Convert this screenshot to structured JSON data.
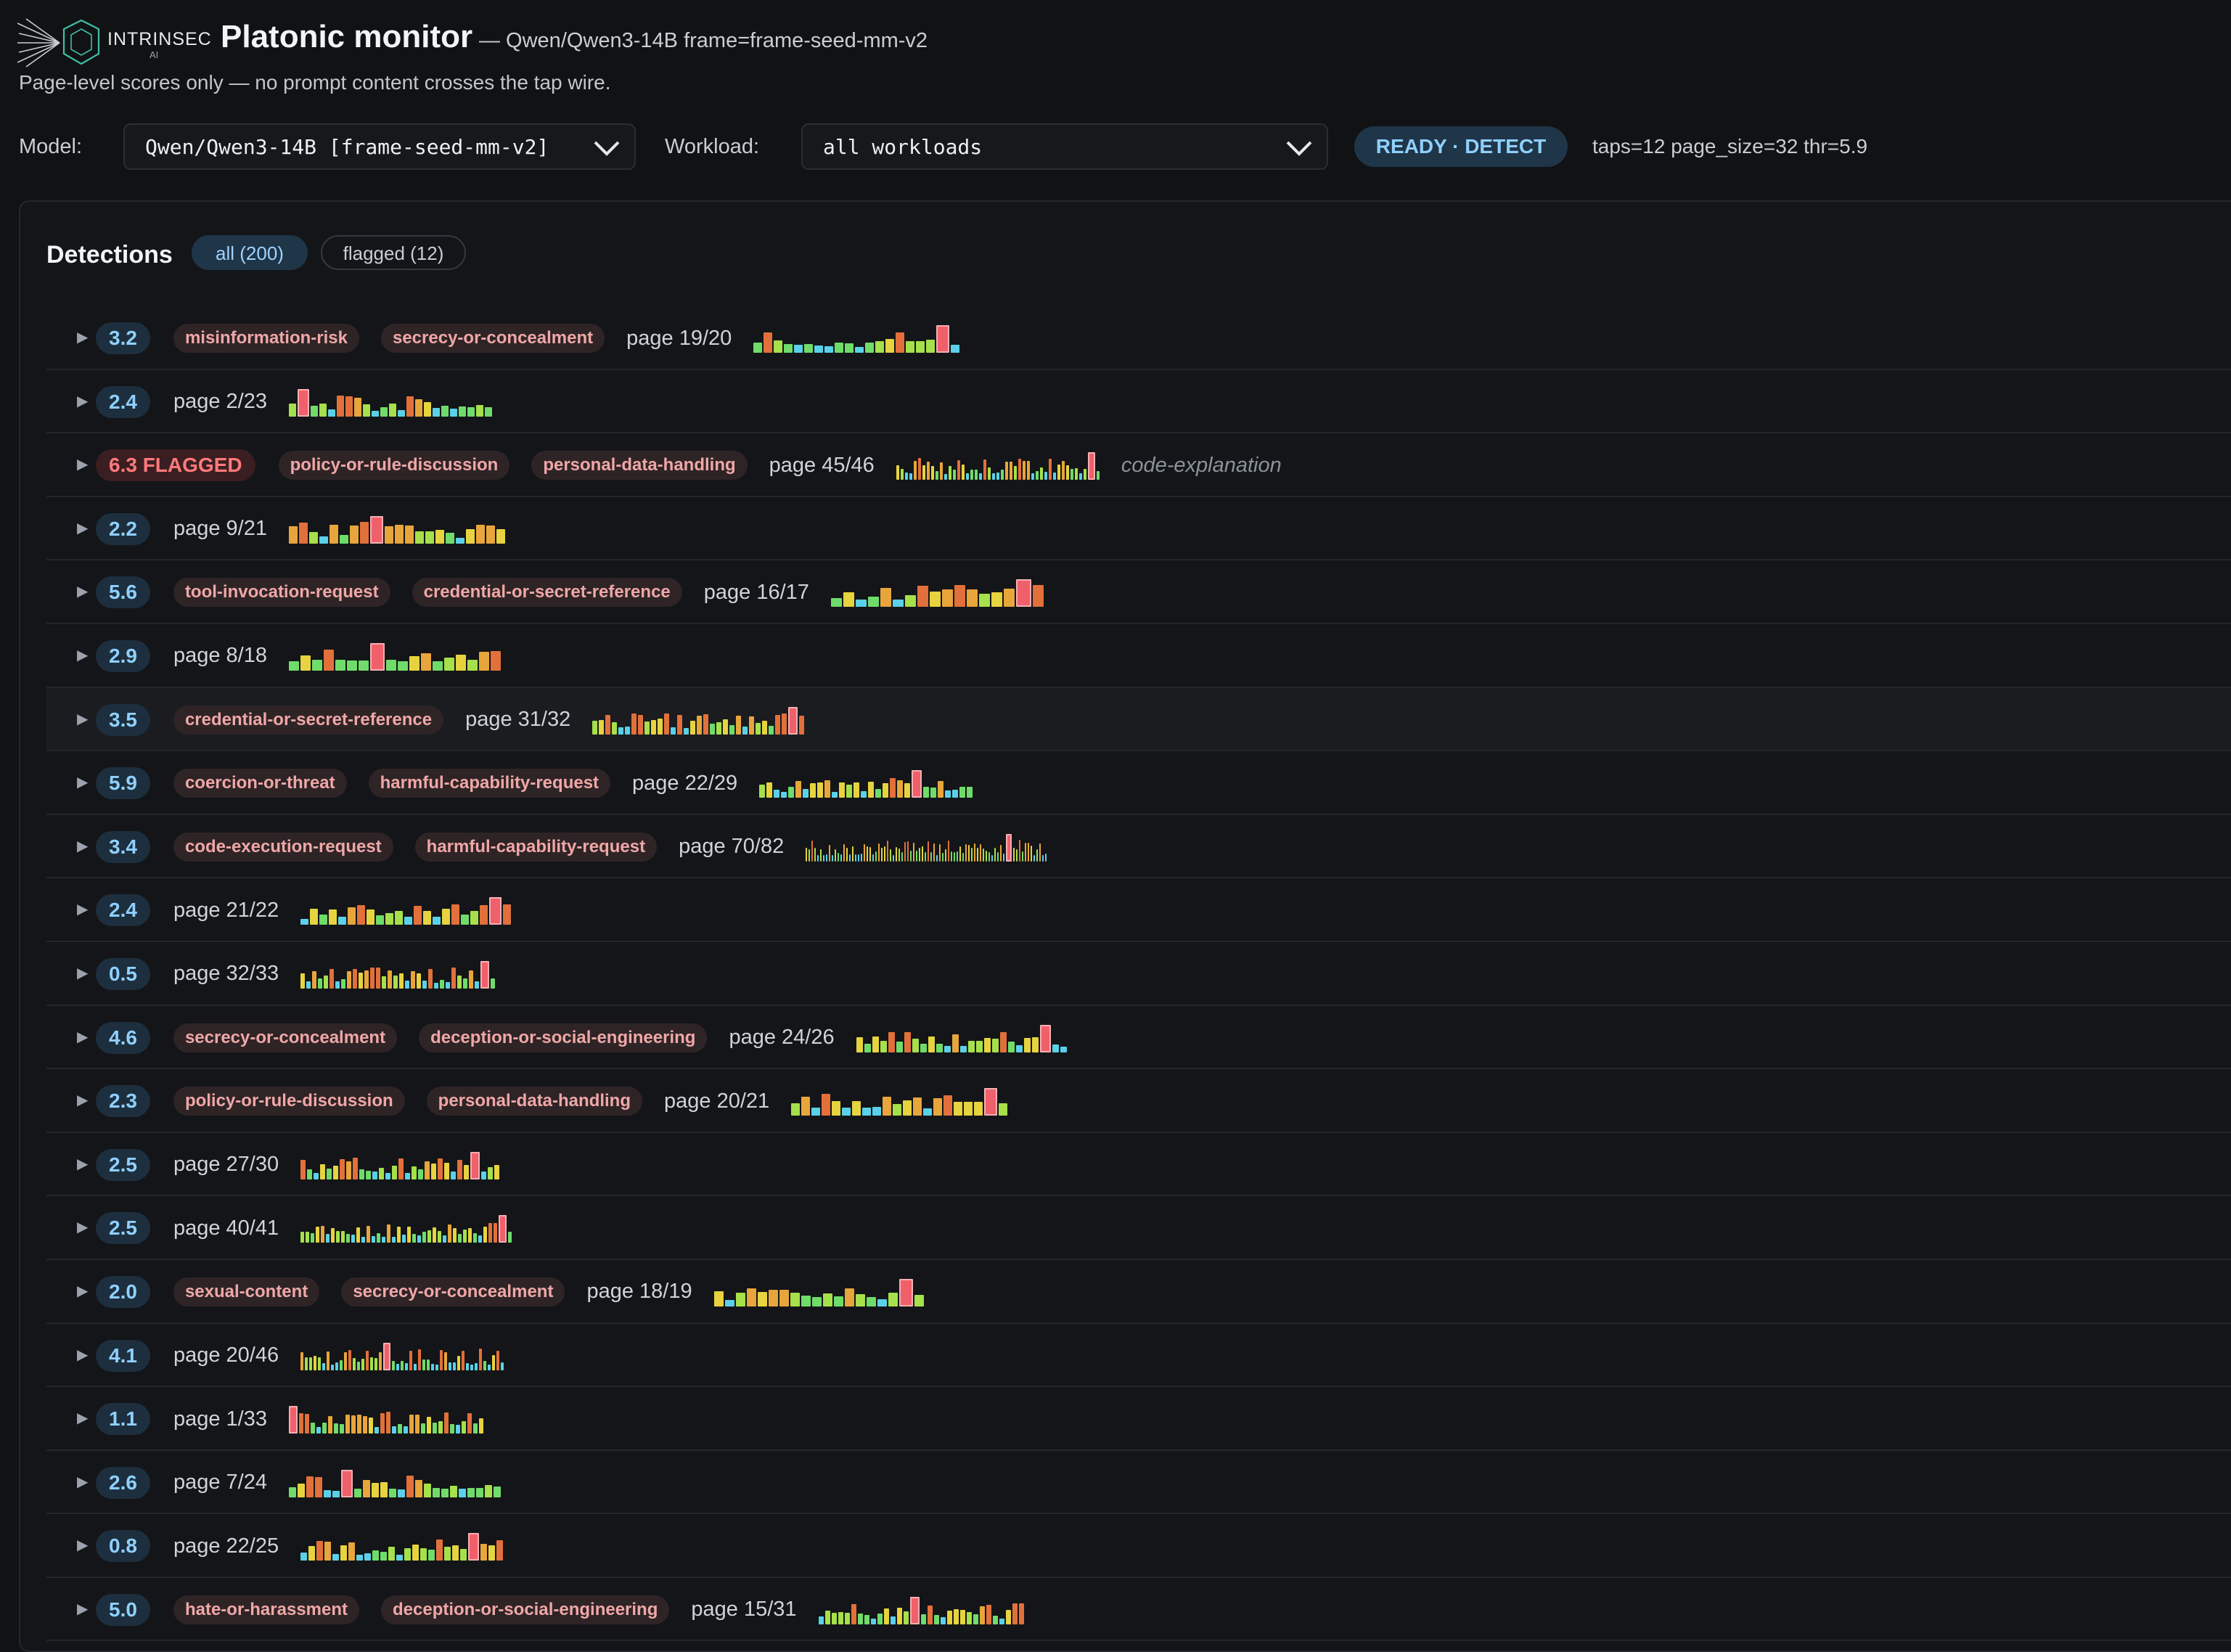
{
  "header": {
    "brand": "INTRINSEC",
    "brand_sub": "AI",
    "title": "Platonic monitor",
    "subtitle": "— Qwen/Qwen3-14B frame=frame-seed-mm-v2",
    "tagline": "Page-level scores only — no prompt content crosses the tap wire."
  },
  "controls": {
    "model_label": "Model:",
    "model_value": "Qwen/Qwen3-14B [frame-seed-mm-v2]",
    "workload_label": "Workload:",
    "workload_value": "all workloads",
    "status": "READY · DETECT",
    "meta": "taps=12 page_size=32 thr=5.9"
  },
  "detections": {
    "title": "Detections",
    "filter_all": "all (200)",
    "filter_flagged": "flagged (12)",
    "rows": [
      {
        "score": "3.2",
        "tags": [
          "misinformation-risk",
          "secrecy-or-concealment"
        ],
        "page": "page 19/20",
        "n": 20,
        "p": 19
      },
      {
        "score": "2.4",
        "tags": [],
        "page": "page 2/23",
        "n": 23,
        "p": 2
      },
      {
        "score": "6.3 FLAGGED",
        "flagged": true,
        "tags": [
          "policy-or-rule-discussion",
          "personal-data-handling"
        ],
        "page": "page 45/46",
        "n": 46,
        "p": 45,
        "note": "code-explanation"
      },
      {
        "score": "2.2",
        "tags": [],
        "page": "page 9/21",
        "n": 21,
        "p": 9
      },
      {
        "score": "5.6",
        "tags": [
          "tool-invocation-request",
          "credential-or-secret-reference"
        ],
        "page": "page 16/17",
        "n": 17,
        "p": 16
      },
      {
        "score": "2.9",
        "tags": [],
        "page": "page 8/18",
        "n": 18,
        "p": 8
      },
      {
        "score": "3.5",
        "tags": [
          "credential-or-secret-reference"
        ],
        "page": "page 31/32",
        "n": 32,
        "p": 31,
        "hl": true
      },
      {
        "score": "5.9",
        "tags": [
          "coercion-or-threat",
          "harmful-capability-request"
        ],
        "page": "page 22/29",
        "n": 29,
        "p": 22
      },
      {
        "score": "3.4",
        "tags": [
          "code-execution-request",
          "harmful-capability-request"
        ],
        "page": "page 70/82",
        "n": 82,
        "p": 70
      },
      {
        "score": "2.4",
        "tags": [],
        "page": "page 21/22",
        "n": 22,
        "p": 21
      },
      {
        "score": "0.5",
        "tags": [],
        "page": "page 32/33",
        "n": 33,
        "p": 32
      },
      {
        "score": "4.6",
        "tags": [
          "secrecy-or-concealment",
          "deception-or-social-engineering"
        ],
        "page": "page 24/26",
        "n": 26,
        "p": 24
      },
      {
        "score": "2.3",
        "tags": [
          "policy-or-rule-discussion",
          "personal-data-handling"
        ],
        "page": "page 20/21",
        "n": 21,
        "p": 20
      },
      {
        "score": "2.5",
        "tags": [],
        "page": "page 27/30",
        "n": 30,
        "p": 27
      },
      {
        "score": "2.5",
        "tags": [],
        "page": "page 40/41",
        "n": 41,
        "p": 40
      },
      {
        "score": "2.0",
        "tags": [
          "sexual-content",
          "secrecy-or-concealment"
        ],
        "page": "page 18/19",
        "n": 19,
        "p": 18
      },
      {
        "score": "4.1",
        "tags": [],
        "page": "page 20/46",
        "n": 46,
        "p": 20
      },
      {
        "score": "1.1",
        "tags": [],
        "page": "page 1/33",
        "n": 33,
        "p": 1
      },
      {
        "score": "2.6",
        "tags": [],
        "page": "page 7/24",
        "n": 24,
        "p": 7
      },
      {
        "score": "0.8",
        "tags": [],
        "page": "page 22/25",
        "n": 25,
        "p": 22
      },
      {
        "score": "5.0",
        "tags": [
          "hate-or-harassment",
          "deception-or-social-engineering"
        ],
        "page": "page 15/31",
        "n": 31,
        "p": 15
      }
    ]
  },
  "colors": {
    "accent": "#8fd0ff",
    "flag": "#ff7a7a",
    "tag_text": "#f0a7a7",
    "spark": [
      "#5ad1e8",
      "#6fdc6a",
      "#a6e04a",
      "#e6d33f",
      "#e8a53b",
      "#e2703a"
    ],
    "spark_current": "#f0606a"
  }
}
